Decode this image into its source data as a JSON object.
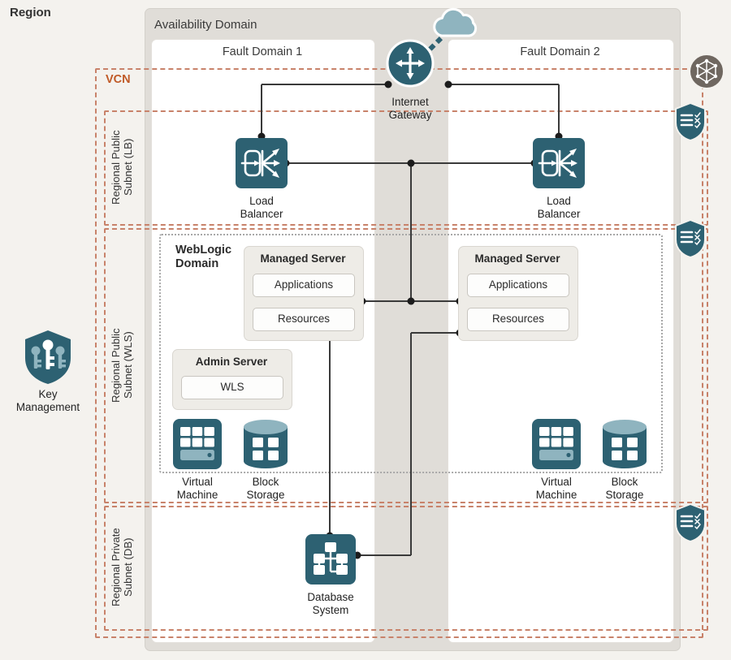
{
  "region": {
    "label": "Region"
  },
  "availability_domain": {
    "label": "Availability Domain"
  },
  "fault_domains": [
    {
      "label": "Fault Domain 1"
    },
    {
      "label": "Fault Domain 2"
    }
  ],
  "vcn": {
    "label": "VCN"
  },
  "subnets": [
    {
      "id": "lb",
      "label": "Regional Public\nSubnet (LB)"
    },
    {
      "id": "wls",
      "label": "Regional Public\nSubnet (WLS)"
    },
    {
      "id": "db",
      "label": "Regional Private\nSubnet (DB)"
    }
  ],
  "weblogic_domain": {
    "label": "WebLogic\nDomain"
  },
  "managed_servers": [
    {
      "title": "Managed Server",
      "items": [
        "Applications",
        "Resources"
      ]
    },
    {
      "title": "Managed Server",
      "items": [
        "Applications",
        "Resources"
      ]
    }
  ],
  "admin_server": {
    "title": "Admin Server",
    "items": [
      "WLS"
    ]
  },
  "icons": {
    "internet_gateway": {
      "name": "internet-gateway-icon",
      "label": "Internet\nGateway"
    },
    "cloud": {
      "name": "cloud-icon",
      "label": ""
    },
    "load_balancer_1": {
      "name": "load-balancer-icon",
      "label": "Load\nBalancer"
    },
    "load_balancer_2": {
      "name": "load-balancer-icon",
      "label": "Load\nBalancer"
    },
    "virtual_machine_1": {
      "name": "virtual-machine-icon",
      "label": "Virtual\nMachine"
    },
    "block_storage_1": {
      "name": "block-storage-icon",
      "label": "Block\nStorage"
    },
    "virtual_machine_2": {
      "name": "virtual-machine-icon",
      "label": "Virtual\nMachine"
    },
    "block_storage_2": {
      "name": "block-storage-icon",
      "label": "Block\nStorage"
    },
    "database_system": {
      "name": "database-system-icon",
      "label": "Database\nSystem"
    },
    "key_management": {
      "name": "key-management-icon",
      "label": "Key\nManagement"
    },
    "route_table": {
      "name": "route-table-icon",
      "label": ""
    },
    "security_list_lb": {
      "name": "security-list-icon",
      "label": ""
    },
    "security_list_wls": {
      "name": "security-list-icon",
      "label": ""
    },
    "security_list_db": {
      "name": "security-list-icon",
      "label": ""
    }
  },
  "colors": {
    "teal": "#2d6172",
    "teal_light": "#8fb4bf",
    "vcn_dash": "#c8826a",
    "vcn_text": "#c05a27",
    "page_bg": "#f4f2ee",
    "ad_bg": "#e0ddd8",
    "fd_bg": "#ffffff",
    "panel_bg": "#eeece7",
    "wire": "#3a3a3a",
    "route_table_circle": "#6f6760"
  }
}
